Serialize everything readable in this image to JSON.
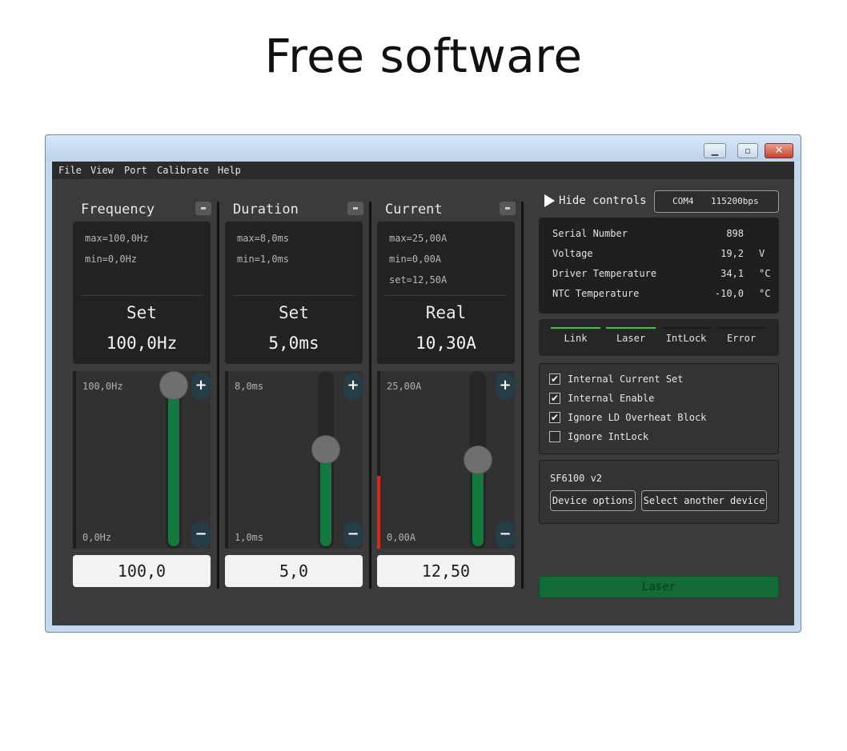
{
  "slide": {
    "title": "Free software"
  },
  "menu": [
    "File",
    "View",
    "Port",
    "Calibrate",
    "Help"
  ],
  "columns": [
    {
      "title": "Frequency",
      "pin": "▬",
      "limits": [
        "max=100,0Hz",
        "min=0,0Hz"
      ],
      "mode": "Set",
      "display": "100,0Hz",
      "range_top": "100,0Hz",
      "range_bottom": "0,0Hz",
      "input_value": "100,0",
      "slider_fraction": 1.0,
      "red_fraction": 0
    },
    {
      "title": "Duration",
      "pin": "▬",
      "limits": [
        "max=8,0ms",
        "min=1,0ms"
      ],
      "mode": "Set",
      "display": "5,0ms",
      "range_top": "8,0ms",
      "range_bottom": "1,0ms",
      "input_value": "5,0",
      "slider_fraction": 0.57,
      "red_fraction": 0
    },
    {
      "title": "Current",
      "pin": "▬",
      "limits": [
        "max=25,00A",
        "min=0,00A",
        "set=12,50A"
      ],
      "mode": "Real",
      "display": "10,30A",
      "range_top": "25,00A",
      "range_bottom": "0,00A",
      "input_value": "12,50",
      "slider_fraction": 0.5,
      "red_fraction": 0.41
    }
  ],
  "controls": {
    "plus": "+",
    "minus": "−"
  },
  "right": {
    "hide_controls": "Hide controls",
    "port": "COM4",
    "baud": "115200bps",
    "info": [
      {
        "label": "Serial Number",
        "value": "898",
        "unit": ""
      },
      {
        "label": "Voltage",
        "value": "19,2",
        "unit": "V"
      },
      {
        "label": "Driver Temperature",
        "value": "34,1",
        "unit": "°C"
      },
      {
        "label": "NTC Temperature",
        "value": "-10,0",
        "unit": "°C"
      }
    ],
    "statuses": [
      {
        "label": "Link",
        "color": "#2ecc40"
      },
      {
        "label": "Laser",
        "color": "#2ecc40"
      },
      {
        "label": "IntLock",
        "color": "#1a1a1a"
      },
      {
        "label": "Error",
        "color": "#1a1a1a"
      }
    ],
    "options": [
      {
        "label": "Internal Current Set",
        "checked": true
      },
      {
        "label": "Internal Enable",
        "checked": true
      },
      {
        "label": "Ignore LD Overheat Block",
        "checked": true
      },
      {
        "label": "Ignore IntLock",
        "checked": false
      }
    ],
    "device_name": "SF6100 v2",
    "device_options": "Device options",
    "select_device": "Select another device",
    "laser_button": "Laser"
  }
}
